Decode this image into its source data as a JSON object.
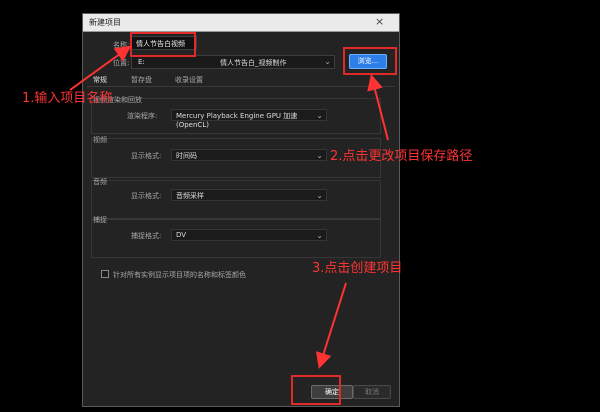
{
  "dialog": {
    "title": "新建项目",
    "close_label": "×",
    "name_label": "名称:",
    "name_value": "情人节告白视频",
    "location_label": "位置:",
    "location_drive": "E:",
    "location_path": "情人节告白_视频制作",
    "browse_label": "浏览...",
    "tabs": [
      "常规",
      "暂存盘",
      "收录设置"
    ],
    "video_render": {
      "title": "视频渲染和回放",
      "renderer_label": "渲染程序:",
      "renderer_value": "Mercury Playback Engine GPU 加速 (OpenCL)"
    },
    "video": {
      "title": "视频",
      "display_label": "显示格式:",
      "display_value": "时间码"
    },
    "audio": {
      "title": "音频",
      "display_label": "显示格式:",
      "display_value": "音频采样"
    },
    "capture": {
      "title": "捕捉",
      "format_label": "捕捉格式:",
      "format_value": "DV"
    },
    "checkbox_label": "针对所有实例显示项目项的名称和标签颜色",
    "ok_label": "确定",
    "cancel_label": "取消"
  },
  "annotations": {
    "step1": "1.输入项目名称",
    "step2": "2.点击更改项目保存路径",
    "step3": "3.点击创建项目",
    "color": "#ff3333"
  }
}
